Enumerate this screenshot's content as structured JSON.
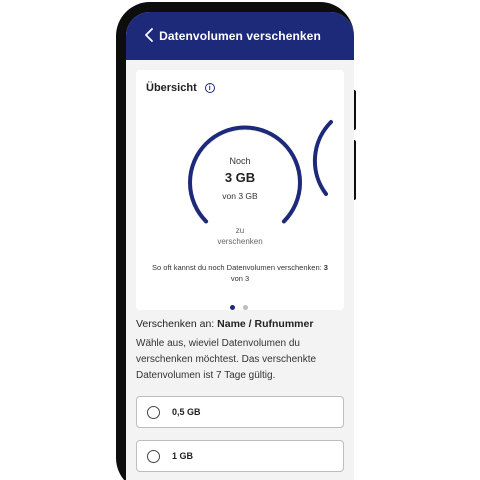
{
  "header": {
    "title": "Datenvolumen verschenken",
    "back_icon": "chevron-left-icon"
  },
  "overview": {
    "title": "Übersicht",
    "info_icon": "info-icon",
    "info_glyph": "i",
    "gauge": {
      "prefix": "Noch",
      "amount": "3 GB",
      "of_total": "von 3 GB",
      "suffix_line1": "zu",
      "suffix_line2": "verschenken",
      "remaining_fraction": 1.0
    },
    "gift_info_text": "So oft kannst du noch Datenvolumen verschenken:",
    "gift_count": "3",
    "gift_count_suffix": "von 3",
    "pagination": {
      "pages": 2,
      "active": 0
    }
  },
  "recipient": {
    "label": "Verschenken an:",
    "value": "Name / Rufnummer"
  },
  "description": "Wähle aus, wieviel Datenvolumen du verschenken möchtest. Das verschenkte Datenvolumen ist 7 Tage gültig.",
  "options": [
    {
      "label": "0,5 GB",
      "selected": false
    },
    {
      "label": "1 GB",
      "selected": false
    }
  ],
  "colors": {
    "primary": "#1d2a7a",
    "background": "#f3f3f3",
    "card": "#ffffff"
  }
}
